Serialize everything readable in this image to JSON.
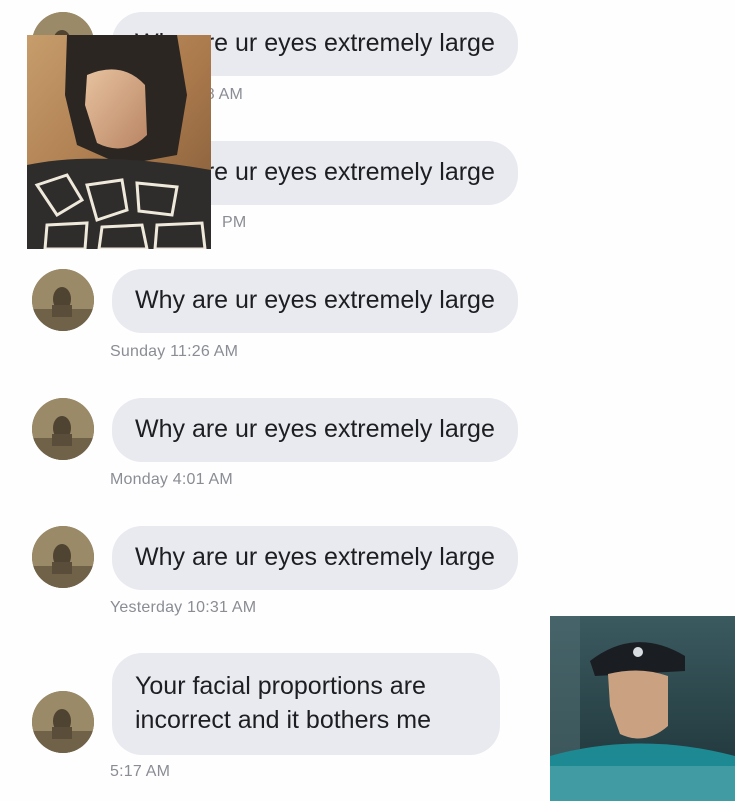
{
  "messages": [
    {
      "text": "Why are ur eyes extremely large",
      "time": "Thursday 3:28 AM"
    },
    {
      "text": "Why are ur eyes extremely large",
      "time": "PM"
    },
    {
      "text": "Why are ur eyes extremely large",
      "time": "Sunday 11:26 AM"
    },
    {
      "text": "Why are ur eyes extremely large",
      "time": "Monday 4:01 AM"
    },
    {
      "text": "Why are ur eyes extremely large",
      "time": "Yesterday 10:31 AM"
    },
    {
      "text": "Your facial proportions are incorrect and it bothers me",
      "time": "5:17 AM"
    }
  ],
  "colors": {
    "bubble": "#e9eaef",
    "text": "#1d1e22",
    "timestamp": "#8a8d94"
  },
  "icons": {
    "avatar": "avatar-photo-icon"
  }
}
